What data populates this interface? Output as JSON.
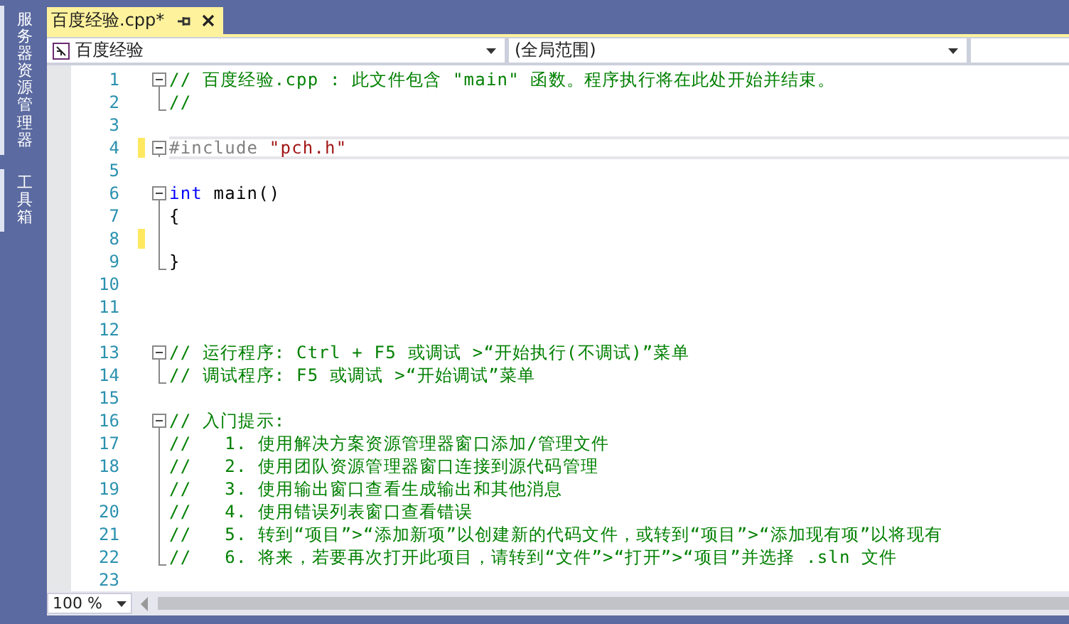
{
  "side_tabs": [
    {
      "label": "服务器资源管理器"
    },
    {
      "label": "工具箱"
    }
  ],
  "tabs": [
    {
      "title": "百度经验.cpp*",
      "selected": true
    }
  ],
  "navigation": {
    "scope_left": "百度经验",
    "scope_right": "(全局范围)"
  },
  "lines": [
    {
      "number": "1",
      "kind": "start",
      "changed": false,
      "current": false,
      "segments": [
        {
          "kind": "comment",
          "text": "// 百度经验.cpp : 此文件包含 \"main\" 函数。程序执行将在此处开始并结束。"
        }
      ]
    },
    {
      "number": "2",
      "kind": "end",
      "changed": false,
      "current": false,
      "segments": [
        {
          "kind": "comment",
          "text": "//"
        }
      ]
    },
    {
      "number": "3",
      "kind": "plain",
      "changed": false,
      "current": false
    },
    {
      "number": "4",
      "kind": "single",
      "changed": true,
      "current": true,
      "segments": [
        {
          "kind": "preproc",
          "text": "#include "
        },
        {
          "kind": "string",
          "text": "\"pch.h\""
        }
      ]
    },
    {
      "number": "5",
      "kind": "plain",
      "changed": false,
      "current": false
    },
    {
      "number": "6",
      "kind": "start",
      "changed": false,
      "current": false,
      "segments": [
        {
          "kind": "keyword",
          "text": "int"
        },
        {
          "kind": "plain",
          "text": " main()"
        }
      ]
    },
    {
      "number": "7",
      "kind": "mid",
      "changed": false,
      "current": false,
      "segments": [
        {
          "kind": "plain",
          "text": "{"
        }
      ]
    },
    {
      "number": "8",
      "kind": "mid",
      "changed": true,
      "current": false
    },
    {
      "number": "9",
      "kind": "end",
      "changed": false,
      "current": false,
      "segments": [
        {
          "kind": "plain",
          "text": "}"
        }
      ]
    },
    {
      "number": "10",
      "kind": "plain",
      "changed": false,
      "current": false
    },
    {
      "number": "11",
      "kind": "plain",
      "changed": false,
      "current": false
    },
    {
      "number": "12",
      "kind": "plain",
      "changed": false,
      "current": false
    },
    {
      "number": "13",
      "kind": "start",
      "changed": false,
      "current": false,
      "segments": [
        {
          "kind": "comment",
          "text": "// 运行程序: Ctrl + F5 或调试 >“开始执行(不调试)”菜单"
        }
      ]
    },
    {
      "number": "14",
      "kind": "end",
      "changed": false,
      "current": false,
      "segments": [
        {
          "kind": "comment",
          "text": "// 调试程序: F5 或调试 >“开始调试”菜单"
        }
      ]
    },
    {
      "number": "15",
      "kind": "plain",
      "changed": false,
      "current": false
    },
    {
      "number": "16",
      "kind": "start",
      "changed": false,
      "current": false,
      "segments": [
        {
          "kind": "comment",
          "text": "// 入门提示:"
        }
      ]
    },
    {
      "number": "17",
      "kind": "mid",
      "changed": false,
      "current": false,
      "segments": [
        {
          "kind": "comment",
          "text": "//   1. 使用解决方案资源管理器窗口添加/管理文件"
        }
      ]
    },
    {
      "number": "18",
      "kind": "mid",
      "changed": false,
      "current": false,
      "segments": [
        {
          "kind": "comment",
          "text": "//   2. 使用团队资源管理器窗口连接到源代码管理"
        }
      ]
    },
    {
      "number": "19",
      "kind": "mid",
      "changed": false,
      "current": false,
      "segments": [
        {
          "kind": "comment",
          "text": "//   3. 使用输出窗口查看生成输出和其他消息"
        }
      ]
    },
    {
      "number": "20",
      "kind": "mid",
      "changed": false,
      "current": false,
      "segments": [
        {
          "kind": "comment",
          "text": "//   4. 使用错误列表窗口查看错误"
        }
      ]
    },
    {
      "number": "21",
      "kind": "mid",
      "changed": false,
      "current": false,
      "segments": [
        {
          "kind": "comment",
          "text": "//   5. 转到“项目”>“添加新项”以创建新的代码文件，或转到“项目”>“添加现有项”以将现有"
        }
      ]
    },
    {
      "number": "22",
      "kind": "end",
      "changed": false,
      "current": false,
      "segments": [
        {
          "kind": "comment",
          "text": "//   6. 将来，若要再次打开此项目，请转到“文件”>“打开”>“项目”并选择 .sln 文件"
        }
      ]
    },
    {
      "number": "23",
      "kind": "plain",
      "changed": false,
      "current": false
    }
  ],
  "zoom": "100 %"
}
